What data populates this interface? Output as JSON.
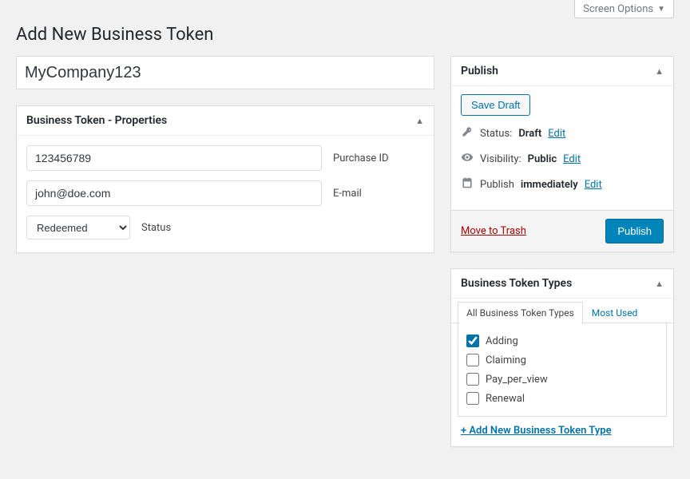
{
  "screen_options": "Screen Options",
  "page_title": "Add New Business Token",
  "title_value": "MyCompany123",
  "properties": {
    "box_title": "Business Token - Properties",
    "purchase_id": {
      "value": "123456789",
      "label": "Purchase ID"
    },
    "email": {
      "value": "john@doe.com",
      "label": "E-mail"
    },
    "status": {
      "value": "Redeemed",
      "label": "Status"
    }
  },
  "publish": {
    "box_title": "Publish",
    "save_draft": "Save Draft",
    "status_label": "Status:",
    "status_value": "Draft",
    "visibility_label": "Visibility:",
    "visibility_value": "Public",
    "publish_label": "Publish",
    "publish_value": "immediately",
    "edit": "Edit",
    "move_trash": "Move to Trash",
    "publish_btn": "Publish"
  },
  "types": {
    "box_title": "Business Token Types",
    "tab_all": "All Business Token Types",
    "tab_most": "Most Used",
    "items": [
      {
        "label": "Adding",
        "checked": true
      },
      {
        "label": "Claiming",
        "checked": false
      },
      {
        "label": "Pay_per_view",
        "checked": false
      },
      {
        "label": "Renewal",
        "checked": false
      }
    ],
    "add_new": "+ Add New Business Token Type"
  }
}
